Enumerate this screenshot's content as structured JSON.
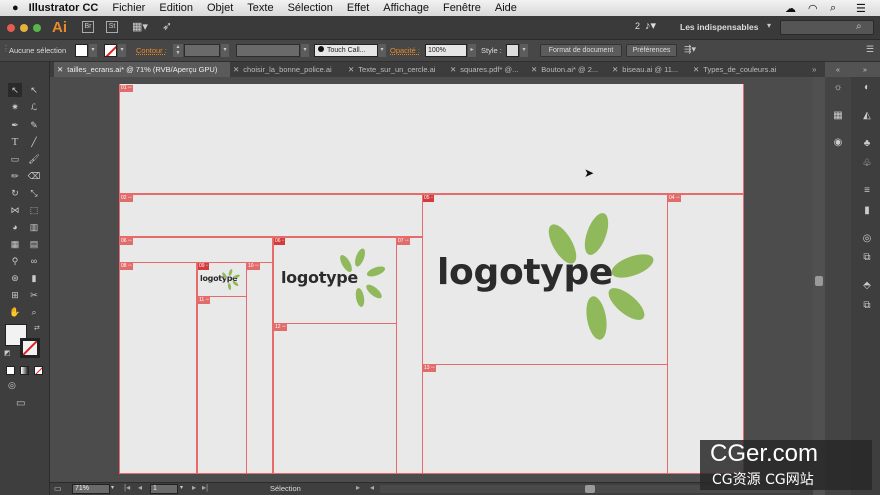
{
  "menubar": {
    "apple": "",
    "app": "Illustrator CC",
    "items": [
      "Fichier",
      "Edition",
      "Objet",
      "Texte",
      "Sélection",
      "Effet",
      "Affichage",
      "Fenêtre",
      "Aide"
    ]
  },
  "appbar": {
    "logo": "Ai",
    "workspace": "Les indispensables",
    "notif_count": "2"
  },
  "control": {
    "selection": "Aucune sélection",
    "stroke_label": "Contour :",
    "brush": "Touch Call...",
    "opacity_label": "Opacité :",
    "opacity_value": "100%",
    "style_label": "Style :",
    "doc_button": "Format de document",
    "pref_button": "Préférences"
  },
  "tabs": [
    "tailles_ecrans.ai* @ 71% (RVB/Aperçu GPU)",
    "choisir_la_bonne_police.ai",
    "Texte_sur_un_cercle.ai",
    "squares.pdf* @...",
    "Bouton.ai* @ 2...",
    "biseau.ai @ 11...",
    "Types_de_couleurs.ai"
  ],
  "slices": {
    "s01": "01",
    "s02": "02",
    "s03": "03",
    "s04": "04",
    "s05": "05",
    "s06": "06",
    "s07": "07",
    "s08": "08",
    "s09": "09",
    "s10": "10",
    "s11": "11",
    "s12": "12",
    "s13": "13"
  },
  "logo_text": "logotype",
  "status": {
    "zoom": "71%",
    "page": "1",
    "tool": "Sélection"
  },
  "watermark": {
    "line1": "CGer.com",
    "line2": "CG资源 CG网站"
  },
  "colors": {
    "slice": "#e86b6b",
    "leaf": "#8fb95a",
    "artboard": "#e9e9e9"
  }
}
